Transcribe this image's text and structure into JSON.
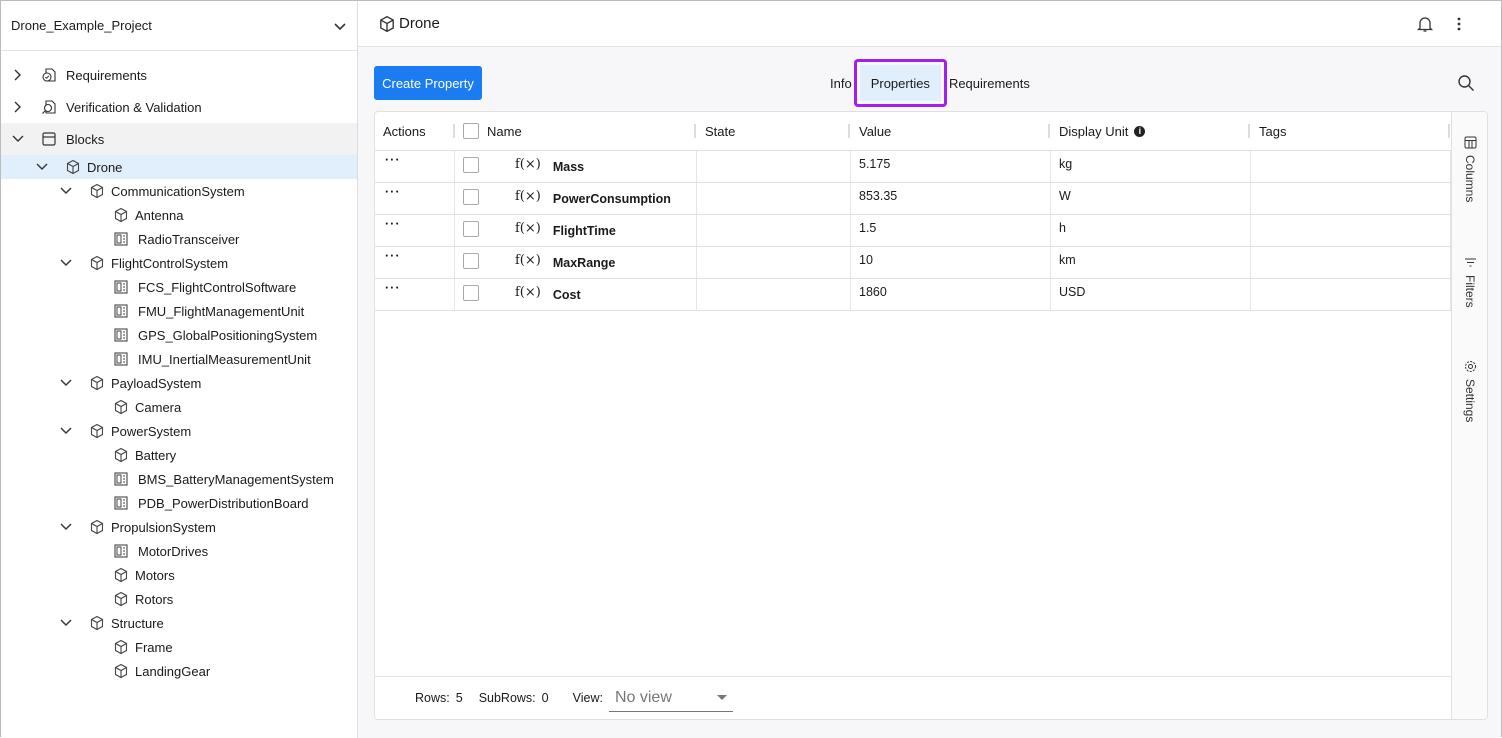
{
  "project": {
    "name": "Drone_Example_Project"
  },
  "tree": [
    {
      "label": "Requirements",
      "level": 0,
      "chevron": "right",
      "icon": "requirements-icon"
    },
    {
      "label": "Verification & Validation",
      "level": 0,
      "chevron": "right",
      "icon": "verification-icon"
    },
    {
      "label": "Blocks",
      "level": 0,
      "chevron": "down",
      "icon": "blocks-icon",
      "hover": true
    },
    {
      "label": "Drone",
      "level": 1,
      "chevron": "down",
      "icon": "cube-icon",
      "selected": true
    },
    {
      "label": "CommunicationSystem",
      "level": 2,
      "chevron": "down",
      "icon": "cube-icon"
    },
    {
      "label": "Antenna",
      "level": 3,
      "icon": "cube-icon"
    },
    {
      "label": "RadioTransceiver",
      "level": 3,
      "icon": "part-icon"
    },
    {
      "label": "FlightControlSystem",
      "level": 2,
      "chevron": "down",
      "icon": "cube-icon"
    },
    {
      "label": "FCS_FlightControlSoftware",
      "level": 3,
      "icon": "part-icon"
    },
    {
      "label": "FMU_FlightManagementUnit",
      "level": 3,
      "icon": "part-icon"
    },
    {
      "label": "GPS_GlobalPositioningSystem",
      "level": 3,
      "icon": "part-icon"
    },
    {
      "label": "IMU_InertialMeasurementUnit",
      "level": 3,
      "icon": "part-icon"
    },
    {
      "label": "PayloadSystem",
      "level": 2,
      "chevron": "down",
      "icon": "cube-icon"
    },
    {
      "label": "Camera",
      "level": 3,
      "icon": "cube-icon"
    },
    {
      "label": "PowerSystem",
      "level": 2,
      "chevron": "down",
      "icon": "cube-icon"
    },
    {
      "label": "Battery",
      "level": 3,
      "icon": "cube-icon"
    },
    {
      "label": "BMS_BatteryManagementSystem",
      "level": 3,
      "icon": "part-icon"
    },
    {
      "label": "PDB_PowerDistributionBoard",
      "level": 3,
      "icon": "part-icon"
    },
    {
      "label": "PropulsionSystem",
      "level": 2,
      "chevron": "down",
      "icon": "cube-icon"
    },
    {
      "label": "MotorDrives",
      "level": 3,
      "icon": "part-icon"
    },
    {
      "label": "Motors",
      "level": 3,
      "icon": "cube-icon"
    },
    {
      "label": "Rotors",
      "level": 3,
      "icon": "cube-icon"
    },
    {
      "label": "Structure",
      "level": 2,
      "chevron": "down",
      "icon": "cube-icon"
    },
    {
      "label": "Frame",
      "level": 3,
      "icon": "cube-icon"
    },
    {
      "label": "LandingGear",
      "level": 3,
      "icon": "cube-icon"
    }
  ],
  "header": {
    "title": "Drone"
  },
  "toolbar": {
    "create_label": "Create Property"
  },
  "tabs": [
    {
      "label": "Info"
    },
    {
      "label": "Properties",
      "active": true
    },
    {
      "label": "Requirements"
    }
  ],
  "table": {
    "columns": [
      "Actions",
      "Name",
      "State",
      "Value",
      "Display Unit",
      "Tags"
    ],
    "rows": [
      {
        "actions": "···",
        "name": "Mass",
        "state": "",
        "value": "5.175",
        "unit": "kg",
        "tags": ""
      },
      {
        "actions": "···",
        "name": "PowerConsumption",
        "state": "",
        "value": "853.35",
        "unit": "W",
        "tags": ""
      },
      {
        "actions": "···",
        "name": "FlightTime",
        "state": "",
        "value": "1.5",
        "unit": "h",
        "tags": ""
      },
      {
        "actions": "···",
        "name": "MaxRange",
        "state": "",
        "value": "10",
        "unit": "km",
        "tags": ""
      },
      {
        "actions": "···",
        "name": "Cost",
        "state": "",
        "value": "1860",
        "unit": "USD",
        "tags": ""
      }
    ],
    "func_symbol": "f(×)"
  },
  "side_panel": {
    "columns": "Columns",
    "filters": "Filters",
    "settings": "Settings"
  },
  "footer": {
    "rows_label": "Rows:",
    "rows": "5",
    "subrows_label": "SubRows:",
    "subrows": "0",
    "view_label": "View:",
    "view_value": "No view"
  },
  "colors": {
    "accent": "#1a7cf0",
    "highlight": "#a020f0",
    "selected": "#e1effd"
  }
}
